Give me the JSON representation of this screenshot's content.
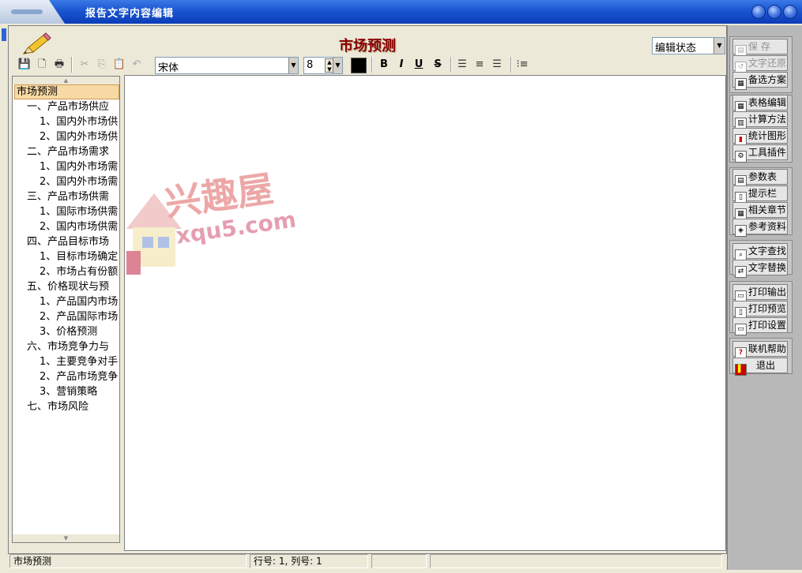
{
  "window": {
    "title": "报告文字内容编辑"
  },
  "document": {
    "title": "市场预测"
  },
  "status_select": {
    "value": "编辑状态"
  },
  "toolbar": {
    "font_name": "宋体",
    "font_size": "8",
    "color": "#000000",
    "bold_label": "B",
    "italic_label": "I",
    "underline_label": "U",
    "strike_label": "S"
  },
  "tree": {
    "items": [
      {
        "label": "市场预测",
        "level": 0,
        "selected": true
      },
      {
        "label": "一、产品市场供应",
        "level": 1
      },
      {
        "label": "1、国内外市场供",
        "level": 2
      },
      {
        "label": "2、国内外市场供",
        "level": 2
      },
      {
        "label": "二、产品市场需求",
        "level": 1
      },
      {
        "label": "1、国内外市场需",
        "level": 2
      },
      {
        "label": "2、国内外市场需",
        "level": 2
      },
      {
        "label": "三、产品市场供需",
        "level": 1
      },
      {
        "label": "1、国际市场供需",
        "level": 2
      },
      {
        "label": "2、国内市场供需",
        "level": 2
      },
      {
        "label": "四、产品目标市场",
        "level": 1
      },
      {
        "label": "1、目标市场确定",
        "level": 2
      },
      {
        "label": "2、市场占有份额",
        "level": 2
      },
      {
        "label": "五、价格现状与预",
        "level": 1
      },
      {
        "label": "1、产品国内市场",
        "level": 2
      },
      {
        "label": "2、产品国际市场",
        "level": 2
      },
      {
        "label": "3、价格预测",
        "level": 2
      },
      {
        "label": "六、市场竞争力与",
        "level": 1
      },
      {
        "label": "1、主要竞争对手",
        "level": 2
      },
      {
        "label": "2、产品市场竞争",
        "level": 2
      },
      {
        "label": "3、营销策略",
        "level": 2
      },
      {
        "label": "七、市场风险",
        "level": 1
      }
    ]
  },
  "right_panel": {
    "save": "保  存",
    "restore": "文字还原",
    "alternatives": "备选方案",
    "table_edit": "表格编辑",
    "calc_method": "计算方法",
    "stat_chart": "统计图形",
    "tool_plugin": "工具插件",
    "param_table": "参数表",
    "hint_bar": "提示栏",
    "related_chapter": "相关章节",
    "reference": "参考资料",
    "find_text": "文字查找",
    "replace_text": "文字替换",
    "print_output": "打印输出",
    "print_preview": "打印预览",
    "print_settings": "打印设置",
    "online_help": "联机帮助",
    "exit": "退出"
  },
  "statusbar": {
    "section": "市场预测",
    "position": "行号:  1,  列号:  1"
  },
  "watermark": {
    "cn": "兴趣屋",
    "en": "xqu5.com"
  }
}
